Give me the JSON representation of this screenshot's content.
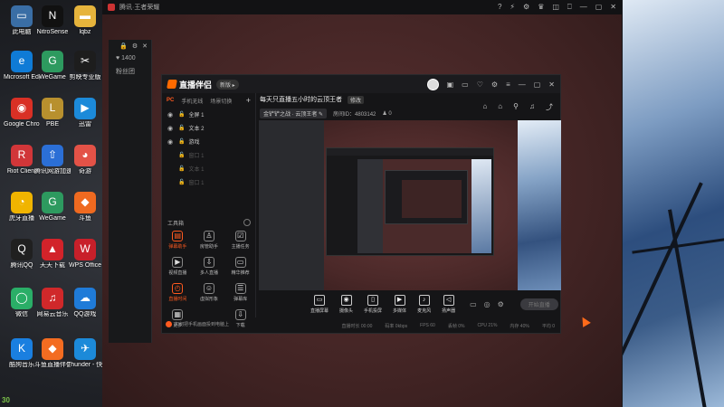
{
  "desktop": {
    "icons": [
      {
        "label": "此电脑",
        "color": "#3a6ea5",
        "glyph": "▭"
      },
      {
        "label": "NitroSense",
        "color": "#111111",
        "glyph": "N"
      },
      {
        "label": "lqbz",
        "color": "#e6b43c",
        "glyph": "▬"
      },
      {
        "label": "Microsoft Edge",
        "color": "#0f7bd6",
        "glyph": "e"
      },
      {
        "label": "WeGame",
        "color": "#2d9a5f",
        "glyph": "G"
      },
      {
        "label": "剪映专业版",
        "color": "#1d1d1d",
        "glyph": "✂"
      },
      {
        "label": "Google Chrome",
        "color": "#d93025",
        "glyph": "◉"
      },
      {
        "label": "PBE",
        "color": "#b8902e",
        "glyph": "L"
      },
      {
        "label": "迅雷",
        "color": "#1c8ad9",
        "glyph": "▶"
      },
      {
        "label": "Riot Client",
        "color": "#d13639",
        "glyph": "R"
      },
      {
        "label": "腾讯网游加速器",
        "color": "#2b6fd6",
        "glyph": "⇧"
      },
      {
        "label": "奇游",
        "color": "#e35247",
        "glyph": "◕"
      },
      {
        "label": "虎牙直播",
        "color": "#f0b400",
        "glyph": "◔"
      },
      {
        "label": "WeGame",
        "color": "#2d9a5f",
        "glyph": "G"
      },
      {
        "label": "斗鱼",
        "color": "#ef6a20",
        "glyph": "◆"
      },
      {
        "label": "腾讯QQ",
        "color": "#202020",
        "glyph": "Q"
      },
      {
        "label": "天天下载",
        "color": "#d2232a",
        "glyph": "▲"
      },
      {
        "label": "WPS Office",
        "color": "#c8202a",
        "glyph": "W"
      },
      {
        "label": "微信",
        "color": "#2aae67",
        "glyph": "◯"
      },
      {
        "label": "网易云音乐",
        "color": "#d0282a",
        "glyph": "♫"
      },
      {
        "label": "QQ游戏",
        "color": "#1f7bd8",
        "glyph": "☁"
      },
      {
        "label": "酷狗音乐",
        "color": "#1a7fe0",
        "glyph": "K"
      },
      {
        "label": "斗鱼直播伴侣",
        "color": "#f36c21",
        "glyph": "◆"
      },
      {
        "label": "Thunder - 快捷方式",
        "color": "#1c8ad9",
        "glyph": "✈"
      }
    ],
    "taskbar_clock": "30"
  },
  "popup": {
    "title": "腾讯·王者荣耀",
    "controls": [
      "?",
      "⚡",
      "⚙",
      "♛",
      "◫",
      "⎕",
      "—",
      "▢",
      "✕"
    ]
  },
  "side_panel": {
    "top_icons": [
      "🔒",
      "⚙",
      "✕"
    ],
    "likes": "1400",
    "fans_label": "粉丝团"
  },
  "app": {
    "logo_text": "直播伴侣",
    "badge": "新版 ▸",
    "title_controls": [
      "▣",
      "▭",
      "♡",
      "⚙",
      "≡",
      "—",
      "▢",
      "✕"
    ],
    "tabs": [
      "PC",
      "手机无线",
      "场景切换",
      "+"
    ],
    "sources": [
      {
        "name": "全屏 1",
        "visible": true
      },
      {
        "name": "文本 2",
        "visible": true
      },
      {
        "name": "游戏",
        "visible": true
      },
      {
        "name": "窗口 1",
        "visible": false
      },
      {
        "name": "文本 1",
        "visible": false
      },
      {
        "name": "窗口 1",
        "visible": false
      }
    ],
    "tools_label": "工具箱",
    "tools": [
      {
        "label": "弹幕助手",
        "icon": "▤",
        "active": true
      },
      {
        "label": "房管助手",
        "icon": "♙",
        "active": false
      },
      {
        "label": "主播任务",
        "icon": "☑",
        "active": false
      },
      {
        "label": "视频直播",
        "icon": "▶",
        "active": false
      },
      {
        "label": "多人直播",
        "icon": "⇩",
        "active": false
      },
      {
        "label": "精华推荐",
        "icon": "▭",
        "active": false
      },
      {
        "label": "直播时间",
        "icon": "◴",
        "active": true
      },
      {
        "label": "虚拟形象",
        "icon": "☺",
        "active": false
      },
      {
        "label": "弹幕库",
        "icon": "☰",
        "active": false
      },
      {
        "label": "更多",
        "icon": "▦",
        "active": false
      },
      {
        "label": "",
        "icon": "",
        "active": false
      },
      {
        "label": "下载",
        "icon": "⇩",
        "active": false
      }
    ],
    "room": {
      "title": "每天只直播五小时的云顶王者",
      "edit_tag": "修改",
      "category": "金铲铲之战 · 云顶王者 ✎",
      "room_id": "房间ID：4803142",
      "online": "♟ 0"
    },
    "room_icons": [
      "⌂",
      "⌂",
      "⚲",
      "♫",
      "⤴"
    ],
    "bottom_buttons": [
      {
        "label": "直播屏幕",
        "icon": "▭"
      },
      {
        "label": "摄像头",
        "icon": "◉"
      },
      {
        "label": "手机投屏",
        "icon": "▯"
      },
      {
        "label": "多媒体",
        "icon": "▶"
      },
      {
        "label": "麦克风",
        "icon": "♪"
      },
      {
        "label": "扬声器",
        "icon": "◁"
      }
    ],
    "bottom_extra": [
      "▭",
      "◎",
      "⚙"
    ],
    "go_live": "开始直播",
    "hint": "如何把手机画面投到电脑上",
    "status": [
      "直播时长 00:00",
      "码率 0kbps",
      "FPS 60",
      "丢帧 0%",
      "CPU 21%",
      "内存 40%",
      "平均 0"
    ]
  }
}
